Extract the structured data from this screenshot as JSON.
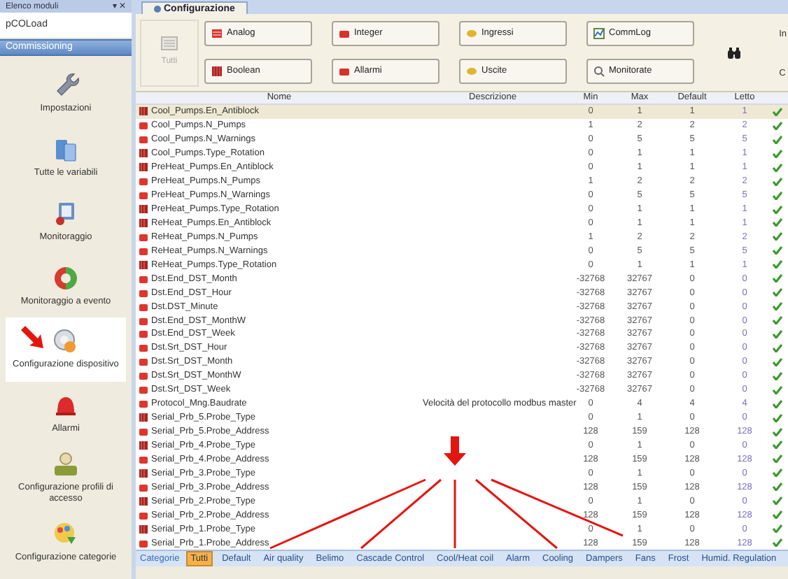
{
  "panel": {
    "title": "Elenco moduli",
    "controls": "▾ ✕"
  },
  "module": "pCOLoad",
  "section": "Commissioning",
  "sidebar_items": [
    {
      "label": "Impostazioni",
      "selected": false
    },
    {
      "label": "Tutte le variabili",
      "selected": false
    },
    {
      "label": "Monitoraggio",
      "selected": false
    },
    {
      "label": "Monitoraggio a evento",
      "selected": false
    },
    {
      "label": "Configurazione dispositivo",
      "selected": true
    },
    {
      "label": "Allarmi",
      "selected": false
    },
    {
      "label": "Configurazione profili di accesso",
      "selected": false
    },
    {
      "label": "Configurazione categorie",
      "selected": false
    }
  ],
  "tab": {
    "label": "Configurazione"
  },
  "toolbar": {
    "all_button": {
      "label": "Tutti",
      "disabled": true
    },
    "filters": [
      {
        "label": "Analog"
      },
      {
        "label": "Integer"
      },
      {
        "label": "Ingressi"
      },
      {
        "label": "CommLog"
      },
      {
        "label": "Boolean"
      },
      {
        "label": "Allarmi"
      },
      {
        "label": "Uscite"
      },
      {
        "label": "Monitorate"
      }
    ],
    "side_labels": [
      "In",
      "C"
    ]
  },
  "table": {
    "columns": [
      "Nome",
      "Descrizione",
      "Min",
      "Max",
      "Default",
      "Letto"
    ],
    "rows": [
      {
        "kind": "boolean",
        "name": "Cool_Pumps.En_Antiblock",
        "min": "0",
        "max": "1",
        "default": "1",
        "read": "1",
        "valid": true,
        "selected": true
      },
      {
        "kind": "integer",
        "name": "Cool_Pumps.N_Pumps",
        "min": "1",
        "max": "2",
        "default": "2",
        "read": "2",
        "valid": true,
        "selected": false
      },
      {
        "kind": "integer",
        "name": "Cool_Pumps.N_Warnings",
        "min": "0",
        "max": "5",
        "default": "5",
        "read": "5",
        "valid": true,
        "selected": false
      },
      {
        "kind": "boolean",
        "name": "Cool_Pumps.Type_Rotation",
        "min": "0",
        "max": "1",
        "default": "1",
        "read": "1",
        "valid": true,
        "selected": false
      },
      {
        "kind": "boolean",
        "name": "PreHeat_Pumps.En_Antiblock",
        "min": "0",
        "max": "1",
        "default": "1",
        "read": "1",
        "valid": true,
        "selected": false
      },
      {
        "kind": "integer",
        "name": "PreHeat_Pumps.N_Pumps",
        "min": "1",
        "max": "2",
        "default": "2",
        "read": "2",
        "valid": true,
        "selected": false
      },
      {
        "kind": "integer",
        "name": "PreHeat_Pumps.N_Warnings",
        "min": "0",
        "max": "5",
        "default": "5",
        "read": "5",
        "valid": true,
        "selected": false
      },
      {
        "kind": "boolean",
        "name": "PreHeat_Pumps.Type_Rotation",
        "min": "0",
        "max": "1",
        "default": "1",
        "read": "1",
        "valid": true,
        "selected": false
      },
      {
        "kind": "boolean",
        "name": "ReHeat_Pumps.En_Antiblock",
        "min": "0",
        "max": "1",
        "default": "1",
        "read": "1",
        "valid": true,
        "selected": false
      },
      {
        "kind": "integer",
        "name": "ReHeat_Pumps.N_Pumps",
        "min": "1",
        "max": "2",
        "default": "2",
        "read": "2",
        "valid": true,
        "selected": false
      },
      {
        "kind": "integer",
        "name": "ReHeat_Pumps.N_Warnings",
        "min": "0",
        "max": "5",
        "default": "5",
        "read": "5",
        "valid": true,
        "selected": false
      },
      {
        "kind": "boolean",
        "name": "ReHeat_Pumps.Type_Rotation",
        "min": "0",
        "max": "1",
        "default": "1",
        "read": "1",
        "valid": true,
        "selected": false
      },
      {
        "kind": "integer",
        "name": "Dst.End_DST_Month",
        "min": "-32768",
        "max": "32767",
        "default": "0",
        "read": "0",
        "valid": true,
        "selected": false
      },
      {
        "kind": "integer",
        "name": "Dst.End_DST_Hour",
        "min": "-32768",
        "max": "32767",
        "default": "0",
        "read": "0",
        "valid": true,
        "selected": false
      },
      {
        "kind": "integer",
        "name": "Dst.DST_Minute",
        "min": "-32768",
        "max": "32767",
        "default": "0",
        "read": "0",
        "valid": true,
        "selected": false
      },
      {
        "kind": "integer",
        "name": "Dst.End_DST_MonthW",
        "min": "-32768",
        "max": "32767",
        "default": "0",
        "read": "0",
        "valid": true,
        "selected": false
      },
      {
        "kind": "integer",
        "name": "Dst.End_DST_Week",
        "min": "-32768",
        "max": "32767",
        "default": "0",
        "read": "0",
        "valid": true,
        "selected": false
      },
      {
        "kind": "integer",
        "name": "Dst.Srt_DST_Hour",
        "min": "-32768",
        "max": "32767",
        "default": "0",
        "read": "0",
        "valid": true,
        "selected": false
      },
      {
        "kind": "integer",
        "name": "Dst.Srt_DST_Month",
        "min": "-32768",
        "max": "32767",
        "default": "0",
        "read": "0",
        "valid": true,
        "selected": false
      },
      {
        "kind": "integer",
        "name": "Dst.Srt_DST_MonthW",
        "min": "-32768",
        "max": "32767",
        "default": "0",
        "read": "0",
        "valid": true,
        "selected": false
      },
      {
        "kind": "integer",
        "name": "Dst.Srt_DST_Week",
        "min": "-32768",
        "max": "32767",
        "default": "0",
        "read": "0",
        "valid": true,
        "selected": false
      },
      {
        "kind": "integer",
        "name": "Protocol_Mng.Baudrate",
        "description": "Velocità del protocollo modbus master",
        "min": "0",
        "max": "4",
        "default": "4",
        "read": "4",
        "valid": true,
        "selected": false
      },
      {
        "kind": "boolean",
        "name": "Serial_Prb_5.Probe_Type",
        "min": "0",
        "max": "1",
        "default": "0",
        "read": "0",
        "valid": true,
        "selected": false
      },
      {
        "kind": "integer",
        "name": "Serial_Prb_5.Probe_Address",
        "min": "128",
        "max": "159",
        "default": "128",
        "read": "128",
        "valid": true,
        "selected": false
      },
      {
        "kind": "boolean",
        "name": "Serial_Prb_4.Probe_Type",
        "min": "0",
        "max": "1",
        "default": "0",
        "read": "0",
        "valid": true,
        "selected": false
      },
      {
        "kind": "integer",
        "name": "Serial_Prb_4.Probe_Address",
        "min": "128",
        "max": "159",
        "default": "128",
        "read": "128",
        "valid": true,
        "selected": false
      },
      {
        "kind": "boolean",
        "name": "Serial_Prb_3.Probe_Type",
        "min": "0",
        "max": "1",
        "default": "0",
        "read": "0",
        "valid": true,
        "selected": false
      },
      {
        "kind": "integer",
        "name": "Serial_Prb_3.Probe_Address",
        "min": "128",
        "max": "159",
        "default": "128",
        "read": "128",
        "valid": true,
        "selected": false
      },
      {
        "kind": "boolean",
        "name": "Serial_Prb_2.Probe_Type",
        "min": "0",
        "max": "1",
        "default": "0",
        "read": "0",
        "valid": true,
        "selected": false
      },
      {
        "kind": "integer",
        "name": "Serial_Prb_2.Probe_Address",
        "min": "128",
        "max": "159",
        "default": "128",
        "read": "128",
        "valid": true,
        "selected": false
      },
      {
        "kind": "boolean",
        "name": "Serial_Prb_1.Probe_Type",
        "min": "0",
        "max": "1",
        "default": "0",
        "read": "0",
        "valid": true,
        "selected": false
      },
      {
        "kind": "integer",
        "name": "Serial_Prb_1.Probe_Address",
        "min": "128",
        "max": "159",
        "default": "128",
        "read": "128",
        "valid": true,
        "selected": false
      }
    ]
  },
  "categories": {
    "label": "Categorie",
    "items": [
      {
        "label": "Tutti",
        "selected": true
      },
      {
        "label": "Default",
        "selected": false
      },
      {
        "label": "Air quality",
        "selected": false
      },
      {
        "label": "Belimo",
        "selected": false
      },
      {
        "label": "Cascade Control",
        "selected": false
      },
      {
        "label": "Cool/Heat coil",
        "selected": false
      },
      {
        "label": "Alarm",
        "selected": false
      },
      {
        "label": "Cooling",
        "selected": false
      },
      {
        "label": "Dampers",
        "selected": false
      },
      {
        "label": "Fans",
        "selected": false
      },
      {
        "label": "Frost",
        "selected": false
      },
      {
        "label": "Humid. Regulation",
        "selected": false
      }
    ]
  }
}
